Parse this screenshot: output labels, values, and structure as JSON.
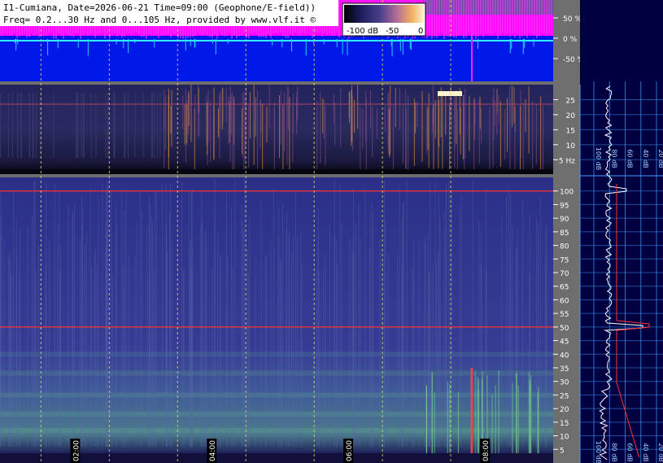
{
  "header": {
    "line1": "I1-Cumiana, Date=2026-06-21 Time=09:00 (Geophone/E-field))",
    "line2": "Freq= 0.2...30 Hz and 0...105 Hz, provided by www.vlf.it ©"
  },
  "colorbar": {
    "labels": [
      "-100 dB",
      "-50",
      "0"
    ],
    "stops": [
      "#000000",
      "#1c1c5a",
      "#4a3f8c",
      "#b06a9a",
      "#f0b060",
      "#fff2d0"
    ]
  },
  "colors": {
    "background": "#6e6e6e",
    "trace_panel": "#0018e8",
    "magenta": "#ff00ff",
    "trace": "#2af0ff",
    "spectrum_bg": "#000040",
    "marker_line": "#e0d860",
    "hum_line": "#ff3030",
    "grid": "#3aa0ff",
    "tick_label": "#ffffff"
  },
  "chart_data": [
    {
      "type": "line",
      "panel": "amplitude",
      "y_ticks": [
        "50 %",
        "0 %",
        "-50 %"
      ],
      "y_values": [
        50,
        0,
        -50
      ],
      "ylim": [
        -100,
        100
      ]
    },
    {
      "type": "heatmap",
      "panel": "low-frequency-spectrogram",
      "y_ticks": [
        "25",
        "20",
        "15",
        "10",
        "5 Hz"
      ],
      "y_values": [
        25,
        20,
        15,
        10,
        5
      ],
      "ylim": [
        0.2,
        30
      ]
    },
    {
      "type": "heatmap",
      "panel": "full-spectrogram",
      "y_ticks": [
        "100",
        "95",
        "90",
        "85",
        "80",
        "75",
        "70",
        "65",
        "60",
        "55",
        "50",
        "45",
        "40",
        "35",
        "30",
        "25",
        "20",
        "15",
        "10",
        "5"
      ],
      "y_values": [
        100,
        95,
        90,
        85,
        80,
        75,
        70,
        65,
        60,
        55,
        50,
        45,
        40,
        35,
        30,
        25,
        20,
        15,
        10,
        5
      ],
      "ylim": [
        0,
        105
      ],
      "x_ticks": [
        "02:00",
        "04:00",
        "06:00",
        "08:00"
      ],
      "x_values": [
        2,
        4,
        6,
        8
      ],
      "xlim": [
        0.9,
        9.0
      ],
      "hum_lines_hz": [
        50,
        100
      ]
    },
    {
      "type": "line",
      "panel": "average-spectrum",
      "x_ticks": [
        "100 dB",
        "80 dB",
        "60 dB",
        "40 dB",
        "20 dB"
      ],
      "x_values": [
        -100,
        -80,
        -60,
        -40,
        -20
      ]
    }
  ]
}
